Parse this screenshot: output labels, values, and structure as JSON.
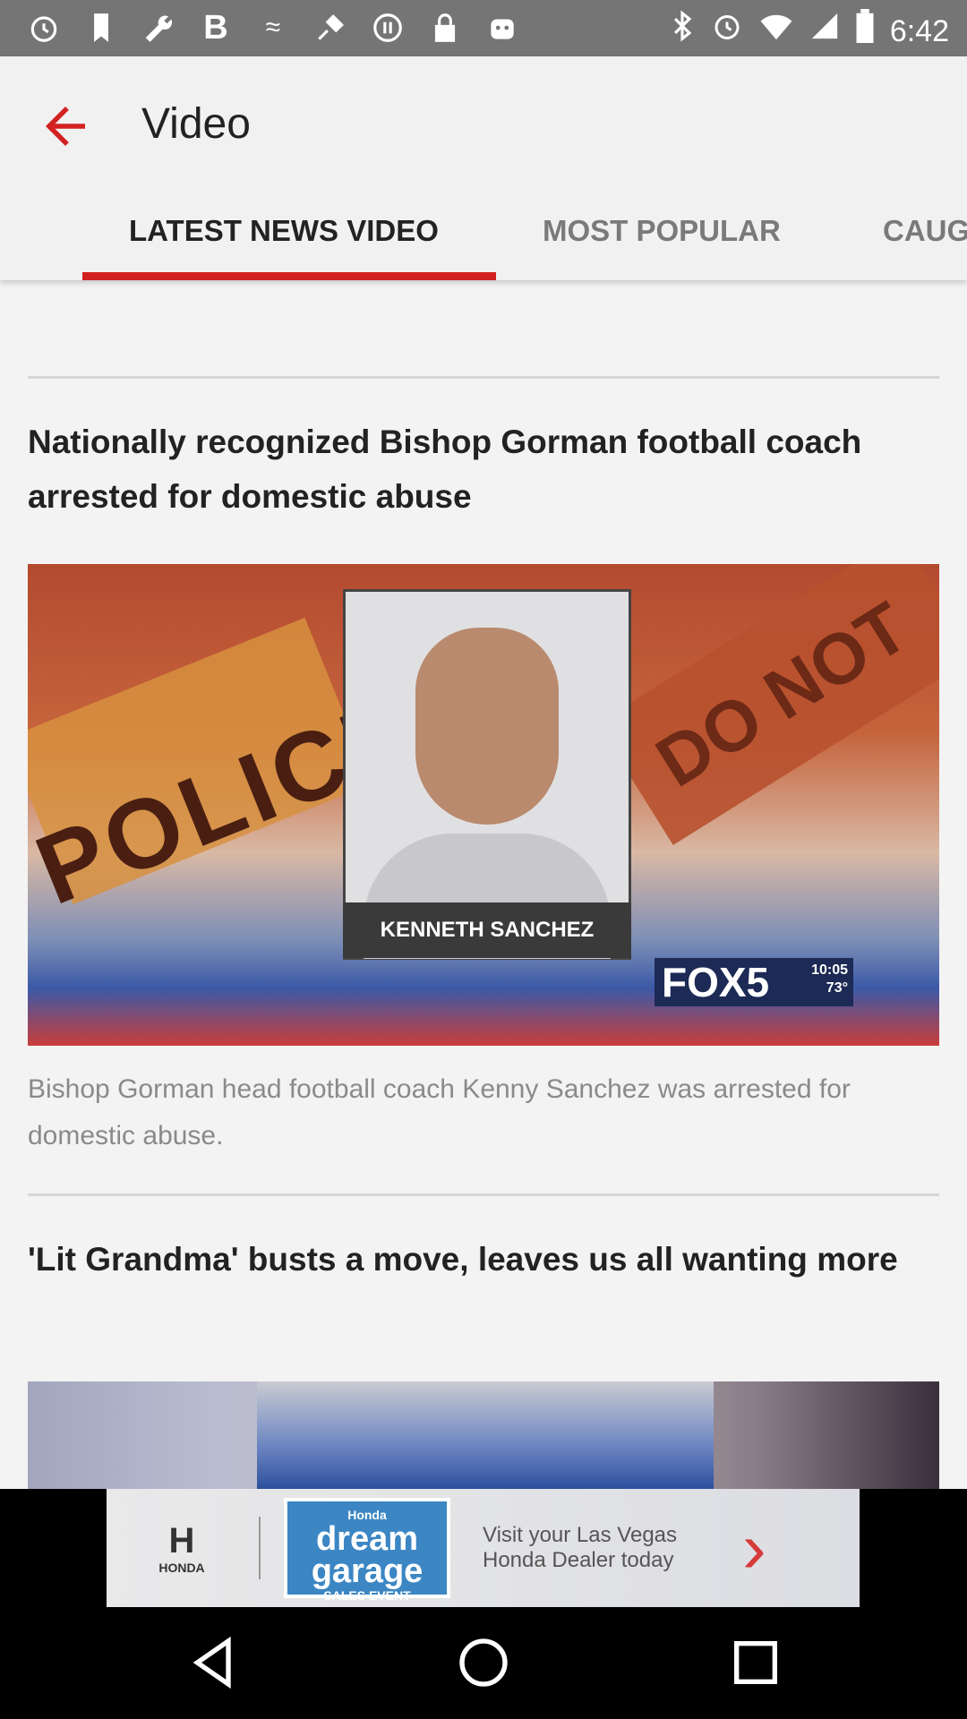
{
  "status_bar": {
    "time": "6:42",
    "left_icons": [
      "alarm-icon",
      "bookmark-icon",
      "wrench-icon",
      "bold-b-icon",
      "swirl-icon",
      "fake-gps-icon",
      "pause-circle-icon",
      "lock-icon",
      "android-icon"
    ],
    "right_icons": [
      "bluetooth-icon",
      "alarm-clock-icon",
      "wifi-icon",
      "signal-icon",
      "battery-icon"
    ]
  },
  "app_bar": {
    "title": "Video",
    "tabs": [
      {
        "label": "LATEST NEWS VIDEO",
        "active": true
      },
      {
        "label": "MOST POPULAR",
        "active": false
      },
      {
        "label": "CAUG",
        "active": false
      }
    ]
  },
  "articles": [
    {
      "headline": "Nationally recognized Bishop Gorman football coach arrested for domestic abuse",
      "image": {
        "police_text": "POLICE",
        "do_not_text": "DO NOT",
        "nameplate": "KENNETH SANCHEZ",
        "logo": "FOX5",
        "logo_time": "10:05",
        "logo_temp": "73°"
      },
      "summary": "Bishop Gorman head football coach Kenny Sanchez was arrested for domestic abuse."
    },
    {
      "headline": "'Lit Grandma' busts a move, leaves us all wanting more"
    }
  ],
  "ad": {
    "brand": "HONDA",
    "dream_top": "Honda",
    "dream_main": "dream garage",
    "dream_sub": "SALES EVENT",
    "message": "Visit your Las Vegas Honda Dealer today"
  },
  "colors": {
    "accent": "#d32121",
    "status_bar": "#757575",
    "app_bar": "#f1f1f1"
  }
}
